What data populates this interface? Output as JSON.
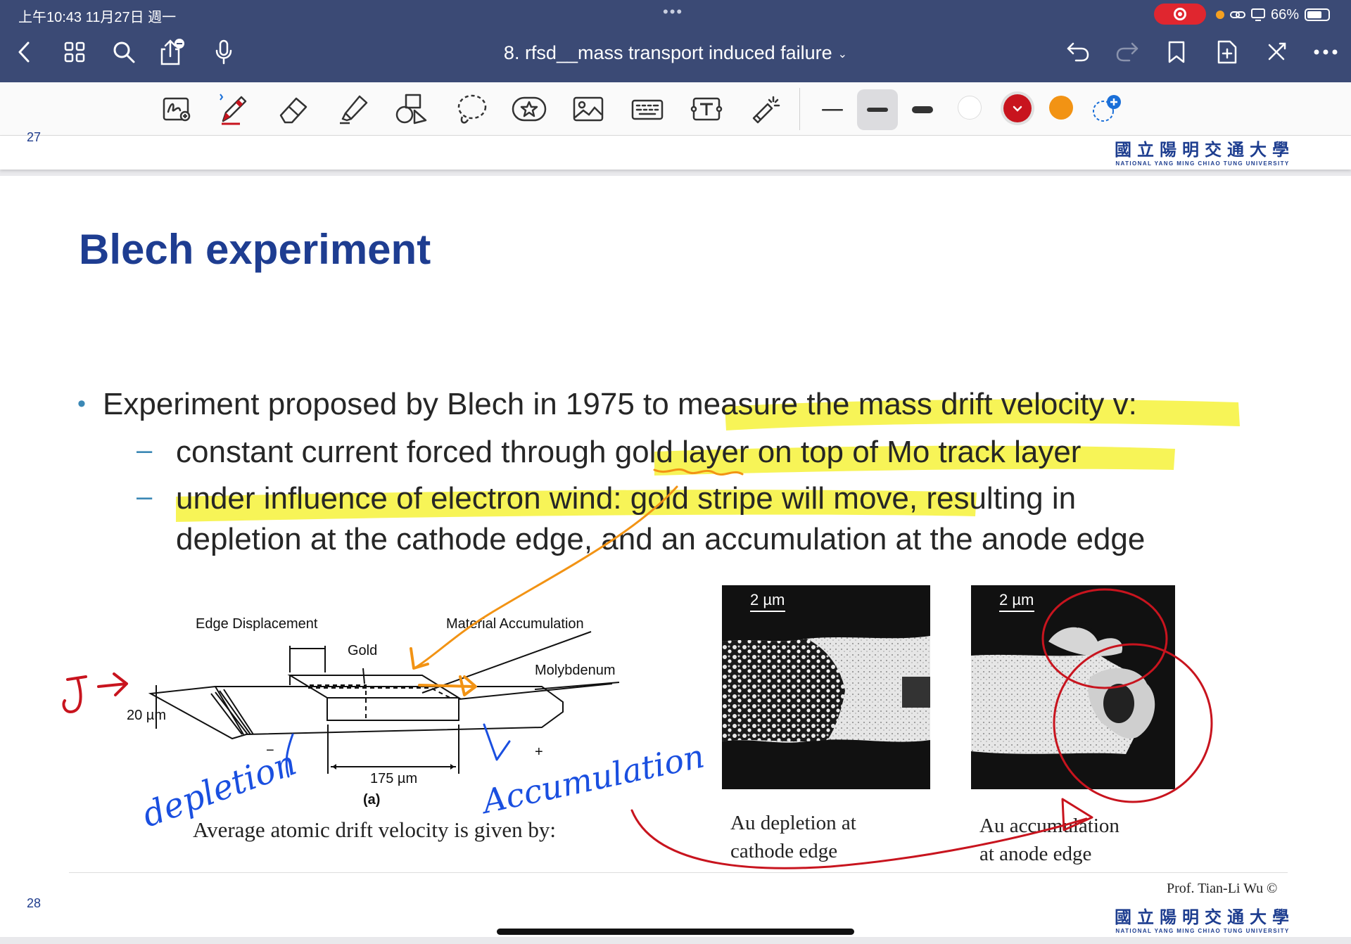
{
  "status_bar": {
    "time_date": "上午10:43   11月27日 週一",
    "battery_percent": "66%"
  },
  "nav": {
    "doc_title": "8. rfsd__mass transport induced failure",
    "icons": [
      "back-icon",
      "grid-icon",
      "search-icon",
      "share-icon",
      "microphone-icon",
      "undo-icon",
      "redo-icon",
      "bookmark-icon",
      "add-page-icon",
      "close-icon",
      "more-icon"
    ]
  },
  "toolbar": {
    "tools": [
      "handwriting-tool",
      "pen-tool",
      "eraser-tool",
      "highlighter-tool",
      "shapes-tool",
      "lasso-tool",
      "sticker-tool",
      "image-tool",
      "keyboard-tool",
      "text-tool",
      "laser-tool"
    ],
    "colors": {
      "white": "#ffffff",
      "red": "#c8141e",
      "orange": "#f29314"
    }
  },
  "prev_page": {
    "number": "27"
  },
  "slide": {
    "logo_cn": "國立陽明交通大學",
    "logo_en": "NATIONAL YANG MING CHIAO TUNG UNIVERSITY",
    "title": "Blech experiment",
    "bullet1": "Experiment proposed by Blech in 1975 to measure the mass drift velocity v:",
    "sub1": "constant current forced through gold layer on top of Mo track layer",
    "sub2_line1": "under influence of electron wind: gold stripe will move, resulting in",
    "sub2_line2": "depletion at the cathode edge, and an accumulation at the anode edge",
    "diagram": {
      "edge_displacement": "Edge Displacement",
      "material_accumulation": "Material Accumulation",
      "gold": "Gold",
      "molybdenum": "Molybdenum",
      "width": "20 µm",
      "length": "175 µm",
      "minus": "−",
      "plus": "+",
      "panel": "(a)"
    },
    "micro_left": {
      "scale": "2 µm",
      "caption_line1": "Au depletion at",
      "caption_line2": "cathode edge"
    },
    "micro_right": {
      "scale": "2 µm",
      "caption_line1": "Au accumulation",
      "caption_line2": "at anode edge"
    },
    "drift_text": "Average atomic drift velocity is given by:",
    "prof": "Prof. Tian-Li Wu ©",
    "page_number": "28"
  },
  "annotations": {
    "j_arrow": "J→",
    "depletion": "depletion",
    "accumulation": "Accumulation",
    "highlight_color": "#f6f23a",
    "ink_blue": "#1a4fe0",
    "ink_red": "#c8141e",
    "ink_orange": "#f29314"
  }
}
